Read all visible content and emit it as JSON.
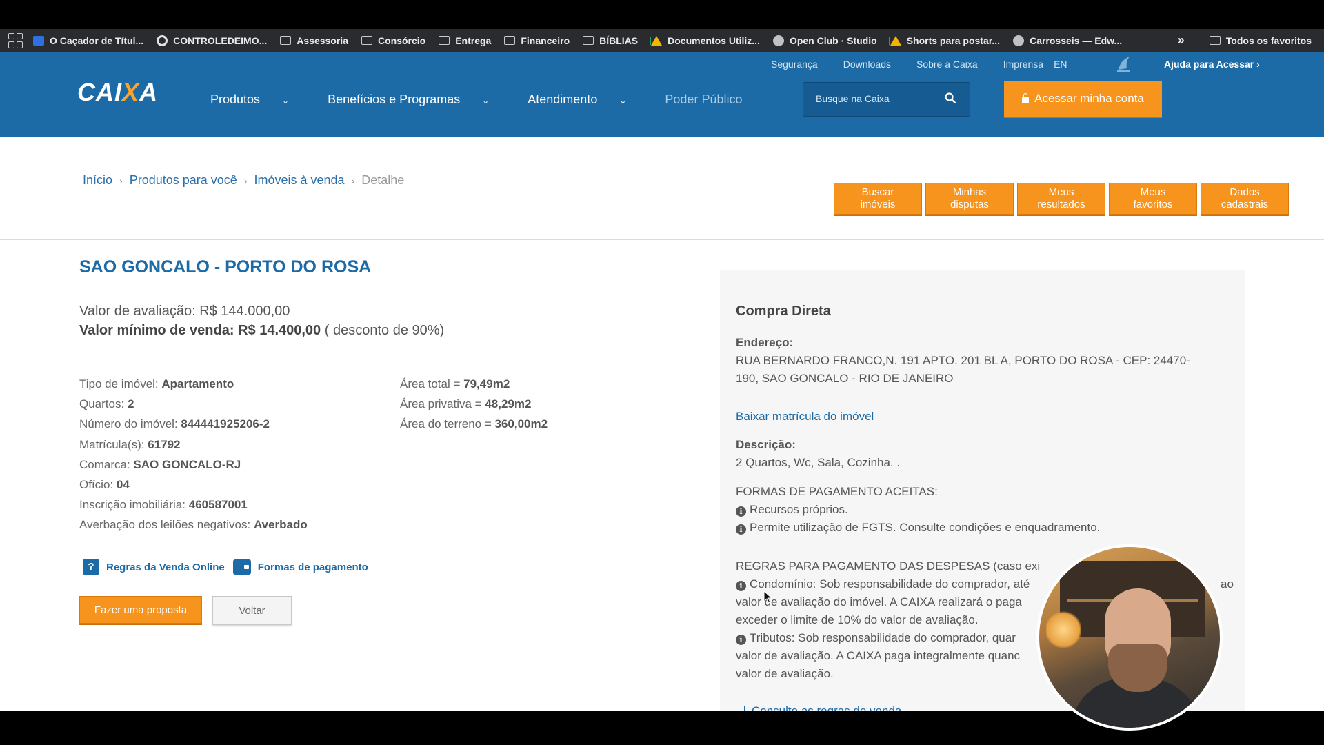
{
  "bookmarks": {
    "items": [
      {
        "label": "O Caçador de Títul...",
        "icon": "k-icon"
      },
      {
        "label": "CONTROLEDEIMO...",
        "icon": "google-icon"
      },
      {
        "label": "Assessoria",
        "icon": "folder-icon"
      },
      {
        "label": "Consórcio",
        "icon": "folder-icon"
      },
      {
        "label": "Entrega",
        "icon": "folder-icon"
      },
      {
        "label": "Financeiro",
        "icon": "folder-icon"
      },
      {
        "label": "BÍBLIAS",
        "icon": "folder-icon"
      },
      {
        "label": "Documentos Utiliz...",
        "icon": "drive-icon"
      },
      {
        "label": "Open Club · Studio",
        "icon": "globe-icon"
      },
      {
        "label": "Shorts para postar...",
        "icon": "drive-icon"
      },
      {
        "label": "Carrosseis — Edw...",
        "icon": "globe-icon"
      }
    ],
    "more": "»",
    "all_bookmarks": "Todos os favoritos"
  },
  "header": {
    "toplinks": [
      "Segurança",
      "Downloads",
      "Sobre a Caixa",
      "Imprensa"
    ],
    "lang": "EN",
    "help": "Ajuda para Acessar ›",
    "logo_left": "CAI",
    "logo_x": "X",
    "logo_right": "A",
    "nav": {
      "produtos": "Produtos",
      "beneficios": "Benefícios e Programas",
      "atendimento": "Atendimento",
      "poder": "Poder Público"
    },
    "search_placeholder": "Busque na Caixa",
    "access_label": "Acessar minha conta"
  },
  "breadcrumb": {
    "inicio": "Início",
    "produtos": "Produtos para você",
    "imoveis": "Imóveis à venda",
    "detalhe": "Detalhe"
  },
  "tabs": [
    {
      "line1": "Buscar",
      "line2": "imóveis"
    },
    {
      "line1": "Minhas",
      "line2": "disputas"
    },
    {
      "line1": "Meus",
      "line2": "resultados"
    },
    {
      "line1": "Meus",
      "line2": "favoritos"
    },
    {
      "line1": "Dados",
      "line2": "cadastrais"
    }
  ],
  "property": {
    "title": "SAO GONCALO - PORTO DO ROSA",
    "valor_avaliacao_label": "Valor de avaliação:",
    "valor_avaliacao": "R$ 144.000,00",
    "valor_minimo_label": "Valor mínimo de venda:",
    "valor_minimo": "R$ 14.400,00",
    "desconto": "( desconto de 90%)",
    "details": [
      {
        "label": "Tipo de imóvel:",
        "value": "Apartamento"
      },
      {
        "label": "Quartos:",
        "value": "2"
      },
      {
        "label": "Número do imóvel:",
        "value": "844441925206-2"
      },
      {
        "label": "Matrícula(s):",
        "value": "61792"
      },
      {
        "label": "Comarca:",
        "value": "SAO GONCALO-RJ"
      },
      {
        "label": "Ofício:",
        "value": "04"
      },
      {
        "label": "Inscrição imobiliária:",
        "value": "460587001"
      },
      {
        "label": "Averbação dos leilões negativos:",
        "value": "Averbado"
      }
    ],
    "areas": [
      {
        "label": "Área total =",
        "value": "79,49m2"
      },
      {
        "label": "Área privativa =",
        "value": "48,29m2"
      },
      {
        "label": "Área do terreno =",
        "value": "360,00m2"
      }
    ],
    "regras_link": "Regras da Venda Online",
    "formas_link": "Formas de pagamento",
    "proposta_btn": "Fazer uma proposta",
    "voltar_btn": "Voltar"
  },
  "panel": {
    "title": "Compra Direta",
    "endereco_label": "Endereço:",
    "endereco_line1": "RUA BERNARDO FRANCO,N. 191 APTO. 201 BL A, PORTO DO ROSA - CEP: 24470-",
    "endereco_line2": "190, SAO GONCALO - RIO DE JANEIRO",
    "matricula_link": "Baixar matrícula do imóvel",
    "descricao_label": "Descrição:",
    "descricao": "2 Quartos, Wc, Sala, Cozinha. .",
    "formas_title": "FORMAS DE PAGAMENTO ACEITAS:",
    "formas": [
      "Recursos próprios.",
      "Permite utilização de FGTS. Consulte condições e enquadramento."
    ],
    "regras_title": "REGRAS PARA PAGAMENTO DAS DESPESAS (caso exi",
    "regra1_line1": "Condomínio: Sob responsabilidade do comprador, até",
    "regra1_end": "ao",
    "regra1_line2": "valor de avaliação do imóvel. A CAIXA realizará o paga",
    "regra1_line3": "exceder o limite de 10% do valor de avaliação.",
    "regra2_line1": "Tributos: Sob responsabilidade do comprador, quar",
    "regra2_line2": "valor de avaliação. A CAIXA paga integralmente quanc",
    "regra2_line3": "valor de avaliação.",
    "bottom_link": "Consulte as regras de venda"
  }
}
